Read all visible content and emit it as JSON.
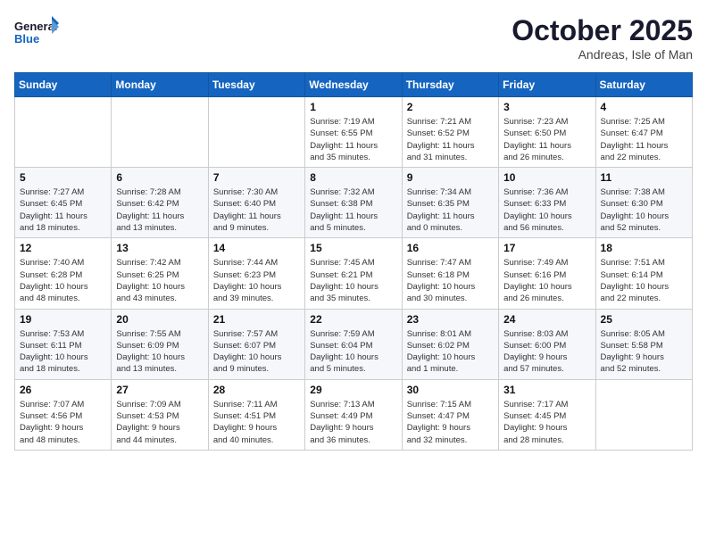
{
  "header": {
    "logo_general": "General",
    "logo_blue": "Blue",
    "month": "October 2025",
    "location": "Andreas, Isle of Man"
  },
  "weekdays": [
    "Sunday",
    "Monday",
    "Tuesday",
    "Wednesday",
    "Thursday",
    "Friday",
    "Saturday"
  ],
  "weeks": [
    [
      {
        "day": "",
        "detail": ""
      },
      {
        "day": "",
        "detail": ""
      },
      {
        "day": "",
        "detail": ""
      },
      {
        "day": "1",
        "detail": "Sunrise: 7:19 AM\nSunset: 6:55 PM\nDaylight: 11 hours\nand 35 minutes."
      },
      {
        "day": "2",
        "detail": "Sunrise: 7:21 AM\nSunset: 6:52 PM\nDaylight: 11 hours\nand 31 minutes."
      },
      {
        "day": "3",
        "detail": "Sunrise: 7:23 AM\nSunset: 6:50 PM\nDaylight: 11 hours\nand 26 minutes."
      },
      {
        "day": "4",
        "detail": "Sunrise: 7:25 AM\nSunset: 6:47 PM\nDaylight: 11 hours\nand 22 minutes."
      }
    ],
    [
      {
        "day": "5",
        "detail": "Sunrise: 7:27 AM\nSunset: 6:45 PM\nDaylight: 11 hours\nand 18 minutes."
      },
      {
        "day": "6",
        "detail": "Sunrise: 7:28 AM\nSunset: 6:42 PM\nDaylight: 11 hours\nand 13 minutes."
      },
      {
        "day": "7",
        "detail": "Sunrise: 7:30 AM\nSunset: 6:40 PM\nDaylight: 11 hours\nand 9 minutes."
      },
      {
        "day": "8",
        "detail": "Sunrise: 7:32 AM\nSunset: 6:38 PM\nDaylight: 11 hours\nand 5 minutes."
      },
      {
        "day": "9",
        "detail": "Sunrise: 7:34 AM\nSunset: 6:35 PM\nDaylight: 11 hours\nand 0 minutes."
      },
      {
        "day": "10",
        "detail": "Sunrise: 7:36 AM\nSunset: 6:33 PM\nDaylight: 10 hours\nand 56 minutes."
      },
      {
        "day": "11",
        "detail": "Sunrise: 7:38 AM\nSunset: 6:30 PM\nDaylight: 10 hours\nand 52 minutes."
      }
    ],
    [
      {
        "day": "12",
        "detail": "Sunrise: 7:40 AM\nSunset: 6:28 PM\nDaylight: 10 hours\nand 48 minutes."
      },
      {
        "day": "13",
        "detail": "Sunrise: 7:42 AM\nSunset: 6:25 PM\nDaylight: 10 hours\nand 43 minutes."
      },
      {
        "day": "14",
        "detail": "Sunrise: 7:44 AM\nSunset: 6:23 PM\nDaylight: 10 hours\nand 39 minutes."
      },
      {
        "day": "15",
        "detail": "Sunrise: 7:45 AM\nSunset: 6:21 PM\nDaylight: 10 hours\nand 35 minutes."
      },
      {
        "day": "16",
        "detail": "Sunrise: 7:47 AM\nSunset: 6:18 PM\nDaylight: 10 hours\nand 30 minutes."
      },
      {
        "day": "17",
        "detail": "Sunrise: 7:49 AM\nSunset: 6:16 PM\nDaylight: 10 hours\nand 26 minutes."
      },
      {
        "day": "18",
        "detail": "Sunrise: 7:51 AM\nSunset: 6:14 PM\nDaylight: 10 hours\nand 22 minutes."
      }
    ],
    [
      {
        "day": "19",
        "detail": "Sunrise: 7:53 AM\nSunset: 6:11 PM\nDaylight: 10 hours\nand 18 minutes."
      },
      {
        "day": "20",
        "detail": "Sunrise: 7:55 AM\nSunset: 6:09 PM\nDaylight: 10 hours\nand 13 minutes."
      },
      {
        "day": "21",
        "detail": "Sunrise: 7:57 AM\nSunset: 6:07 PM\nDaylight: 10 hours\nand 9 minutes."
      },
      {
        "day": "22",
        "detail": "Sunrise: 7:59 AM\nSunset: 6:04 PM\nDaylight: 10 hours\nand 5 minutes."
      },
      {
        "day": "23",
        "detail": "Sunrise: 8:01 AM\nSunset: 6:02 PM\nDaylight: 10 hours\nand 1 minute."
      },
      {
        "day": "24",
        "detail": "Sunrise: 8:03 AM\nSunset: 6:00 PM\nDaylight: 9 hours\nand 57 minutes."
      },
      {
        "day": "25",
        "detail": "Sunrise: 8:05 AM\nSunset: 5:58 PM\nDaylight: 9 hours\nand 52 minutes."
      }
    ],
    [
      {
        "day": "26",
        "detail": "Sunrise: 7:07 AM\nSunset: 4:56 PM\nDaylight: 9 hours\nand 48 minutes."
      },
      {
        "day": "27",
        "detail": "Sunrise: 7:09 AM\nSunset: 4:53 PM\nDaylight: 9 hours\nand 44 minutes."
      },
      {
        "day": "28",
        "detail": "Sunrise: 7:11 AM\nSunset: 4:51 PM\nDaylight: 9 hours\nand 40 minutes."
      },
      {
        "day": "29",
        "detail": "Sunrise: 7:13 AM\nSunset: 4:49 PM\nDaylight: 9 hours\nand 36 minutes."
      },
      {
        "day": "30",
        "detail": "Sunrise: 7:15 AM\nSunset: 4:47 PM\nDaylight: 9 hours\nand 32 minutes."
      },
      {
        "day": "31",
        "detail": "Sunrise: 7:17 AM\nSunset: 4:45 PM\nDaylight: 9 hours\nand 28 minutes."
      },
      {
        "day": "",
        "detail": ""
      }
    ]
  ]
}
